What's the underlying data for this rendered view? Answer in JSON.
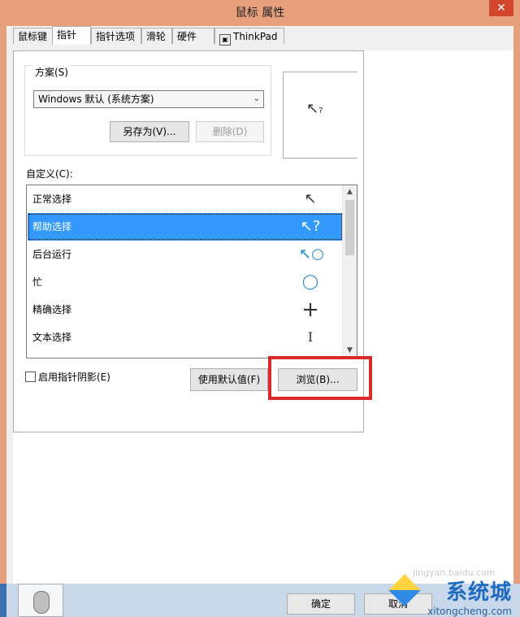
{
  "window": {
    "title": "鼠标 属性",
    "close_glyph": "✕"
  },
  "tabs": [
    {
      "label": "鼠标键"
    },
    {
      "label": "指针"
    },
    {
      "label": "指针选项"
    },
    {
      "label": "滑轮"
    },
    {
      "label": "硬件"
    },
    {
      "label": "ThinkPad"
    }
  ],
  "scheme": {
    "group_label": "方案(S)",
    "selected": "Windows 默认 (系统方案)",
    "save_as_label": "另存为(V)...",
    "delete_label": "删除(D)"
  },
  "customize": {
    "label": "自定义(C):",
    "items": [
      {
        "label": "正常选择",
        "icon": "arrow-cursor-icon",
        "glyph": "↖"
      },
      {
        "label": "帮助选择",
        "icon": "help-cursor-icon",
        "glyph": "↖?",
        "selected": true
      },
      {
        "label": "后台运行",
        "icon": "working-cursor-icon",
        "glyph": "↖○"
      },
      {
        "label": "忙",
        "icon": "busy-cursor-icon",
        "glyph": "◯"
      },
      {
        "label": "精确选择",
        "icon": "crosshair-cursor-icon",
        "glyph": "+"
      },
      {
        "label": "文本选择",
        "icon": "text-cursor-icon",
        "glyph": "I"
      }
    ]
  },
  "options": {
    "shadow_label": "启用指针阴影(E)",
    "shadow_checked": false,
    "use_default_label": "使用默认值(F)",
    "browse_label": "浏览(B)..."
  },
  "footer": {
    "ok_label": "确定",
    "cancel_label": "取消"
  },
  "watermark": {
    "brand": "系统城",
    "url": "xitongcheng.com",
    "baidu": "jingyan.baidu.com"
  },
  "colors": {
    "selection": "#3399ff",
    "highlight_border": "#d82a2a",
    "frame": "#e8a07c"
  }
}
